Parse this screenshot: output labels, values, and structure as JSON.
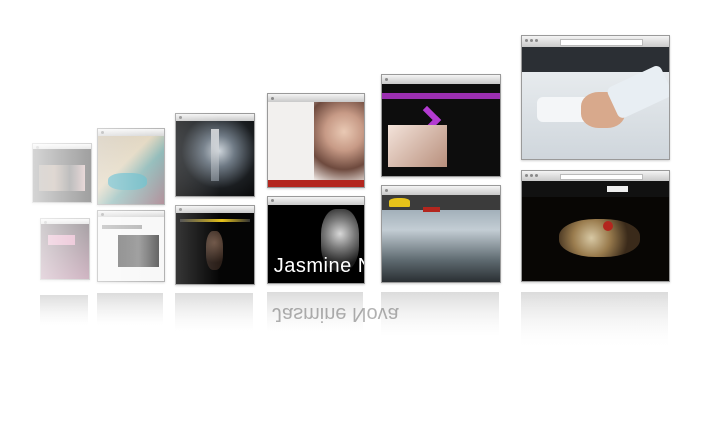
{
  "showcase": {
    "title_banner": "Jasmine Nova"
  },
  "colors": {
    "background": "#ffffff",
    "window_frame": "#9a9a9a",
    "chrome": "#dcdcdc",
    "accent_purple": "#9b2fb0",
    "accent_yellow": "#e6c21a",
    "accent_red": "#b3261e"
  },
  "windows_top_row": [
    {
      "name": "top-1",
      "theme": "dark-collage"
    },
    {
      "name": "top-2",
      "theme": "colorful-collage"
    },
    {
      "name": "top-3",
      "theme": "waterfall"
    },
    {
      "name": "top-4",
      "theme": "woman-portrait"
    },
    {
      "name": "top-5",
      "theme": "purple-hands"
    },
    {
      "name": "top-6",
      "theme": "handshake"
    }
  ],
  "windows_bottom_row": [
    {
      "name": "bottom-1",
      "theme": "pink-dark"
    },
    {
      "name": "bottom-2",
      "theme": "white-photos"
    },
    {
      "name": "bottom-3",
      "theme": "dark-portrait"
    },
    {
      "name": "bottom-4",
      "theme": "jasmine-nova"
    },
    {
      "name": "bottom-5",
      "theme": "ocean"
    },
    {
      "name": "bottom-6",
      "theme": "frog"
    }
  ]
}
